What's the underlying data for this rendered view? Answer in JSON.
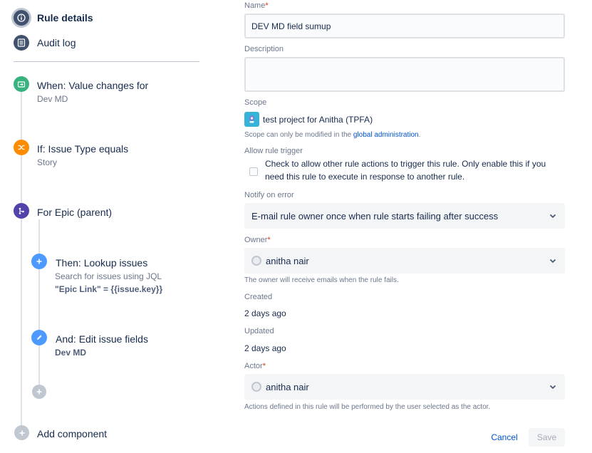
{
  "nav": {
    "rule_details": "Rule details",
    "audit_log": "Audit log"
  },
  "components": {
    "trigger": {
      "title": "When: Value changes for",
      "sub": "Dev MD"
    },
    "condition": {
      "title": "If: Issue Type equals",
      "sub": "Story"
    },
    "branch": {
      "title": "For Epic (parent)"
    },
    "lookup": {
      "title": "Then: Lookup issues",
      "sub": "Search for issues using JQL",
      "code": "\"Epic Link\" = {{issue.key}}"
    },
    "edit": {
      "title": "And: Edit issue fields",
      "code": "Dev MD"
    },
    "add_component": "Add component"
  },
  "form": {
    "name_label": "Name",
    "name_value": "DEV MD field sumup",
    "description_label": "Description",
    "description_value": "",
    "scope_label": "Scope",
    "scope_value": "test project for Anitha (TPFA)",
    "scope_helper_prefix": "Scope can only be modified in the ",
    "scope_helper_link": "global administration",
    "scope_helper_suffix": ".",
    "allow_trigger_label": "Allow rule trigger",
    "allow_trigger_text": "Check to allow other rule actions to trigger this rule. Only enable this if you need this rule to execute in response to another rule.",
    "notify_label": "Notify on error",
    "notify_value": "E-mail rule owner once when rule starts failing after success",
    "owner_label": "Owner",
    "owner_value": "anitha nair",
    "owner_helper": "The owner will receive emails when the rule fails.",
    "created_label": "Created",
    "created_value": "2 days ago",
    "updated_label": "Updated",
    "updated_value": "2 days ago",
    "actor_label": "Actor",
    "actor_value": "anitha nair",
    "actor_helper": "Actions defined in this rule will be performed by the user selected as the actor.",
    "required_mark": "*"
  },
  "buttons": {
    "cancel": "Cancel",
    "save": "Save"
  },
  "colors": {
    "trigger": "#36b37e",
    "condition": "#ff8b00",
    "branch": "#5243aa",
    "action": "#4c9aff",
    "add": "#c1c7d0",
    "link": "#0052cc"
  }
}
